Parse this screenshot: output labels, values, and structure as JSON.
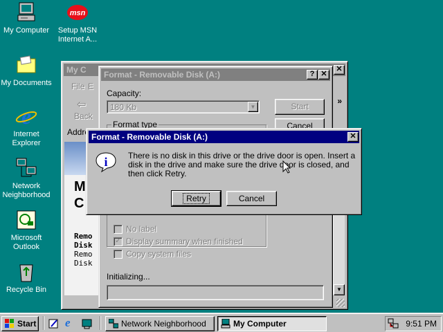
{
  "desktop": {
    "icons": [
      {
        "label": "My Computer"
      },
      {
        "label": "Setup MSN Internet A..."
      },
      {
        "label": "My Documents"
      },
      {
        "label": "Internet Explorer"
      },
      {
        "label": "Network Neighborhood"
      },
      {
        "label": "Microsoft Outlook"
      },
      {
        "label": "Recycle Bin"
      }
    ]
  },
  "explorer": {
    "title": "My C",
    "menu_file": "File",
    "menu_edit": "E",
    "back_label": "Back",
    "address_label": "Addre",
    "big_text_1": "M",
    "big_text_2": "C",
    "side_title": "Remo Disk",
    "side_text": "Remo Disk"
  },
  "format_dialog": {
    "title": "Format - Removable Disk (A:)",
    "capacity_label": "Capacity:",
    "capacity_value": "180 Kb",
    "start_button": "Start",
    "cancel_button": "Cancel",
    "format_type_label": "Format type",
    "options": [
      {
        "label": "No label",
        "checked": false
      },
      {
        "label": "Display summary when finished",
        "checked": true
      },
      {
        "label": "Copy system files",
        "checked": false
      }
    ],
    "status": "Initializing..."
  },
  "error_dialog": {
    "title": "Format - Removable Disk (A:)",
    "message": "There is no disk in this drive or the drive door is open. Insert a disk in the drive and make sure the drive door is closed, and then click Retry.",
    "retry_button": "Retry",
    "cancel_button": "Cancel"
  },
  "taskbar": {
    "start_label": "Start",
    "tasks": [
      {
        "label": "Network Neighborhood",
        "active": false
      },
      {
        "label": "My Computer",
        "active": true
      }
    ],
    "clock": "9:51 PM"
  },
  "colors": {
    "desktop": "#008080",
    "active_title": "#000080",
    "inactive_title": "#808080",
    "face": "#c0c0c0"
  }
}
